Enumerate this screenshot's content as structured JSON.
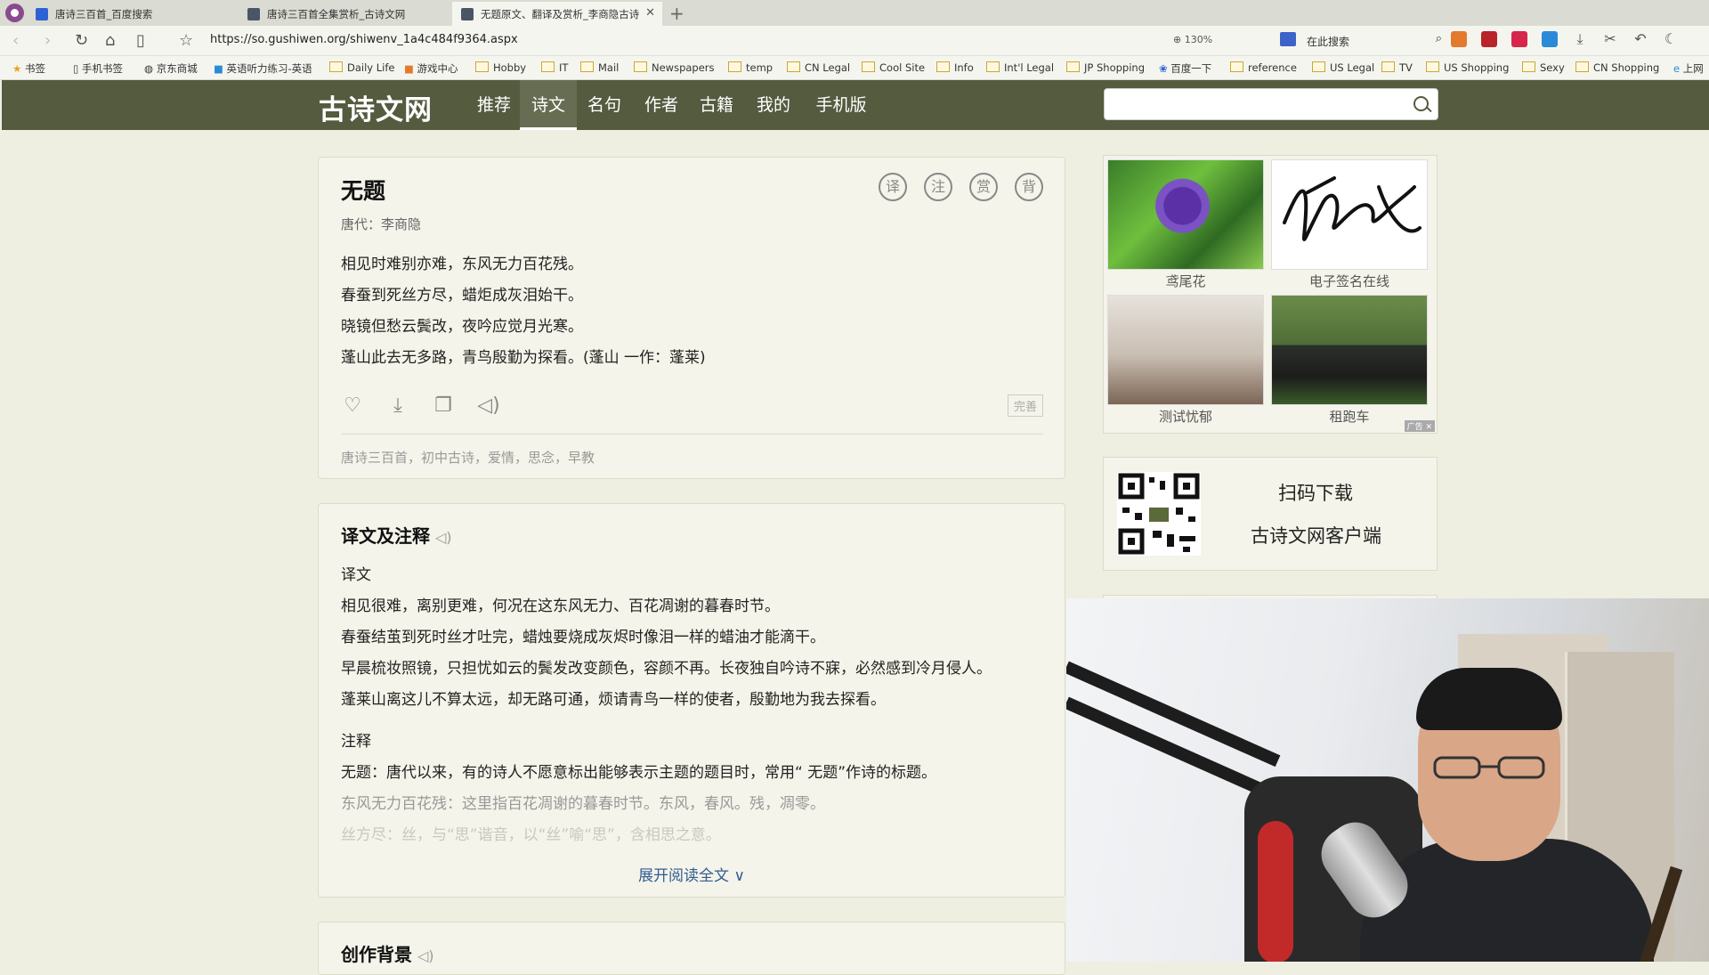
{
  "tabs": [
    {
      "title": "唐诗三百首_百度搜索"
    },
    {
      "title": "唐诗三百首全集赏析_古诗文网"
    },
    {
      "title": "无题原文、翻译及赏析_李商隐古诗"
    }
  ],
  "browser": {
    "url": "https://so.gushiwen.org/shiwenv_1a4c484f9364.aspx",
    "zoom": "130%",
    "search_placeholder": "在此搜索"
  },
  "bookmarks": [
    "书签",
    "手机书签",
    "京东商城",
    "英语听力练习-英语",
    "Daily Life",
    "游戏中心",
    "Hobby",
    "IT",
    "Mail",
    "Newspapers",
    "temp",
    "CN Legal",
    "Cool Site",
    "Info",
    "Int'l Legal",
    "JP Shopping",
    "百度一下",
    "reference",
    "US Legal",
    "TV",
    "US Shopping",
    "Sexy",
    "CN Shopping",
    "上网"
  ],
  "site": {
    "logo": "古诗文网",
    "nav": [
      "推荐",
      "诗文",
      "名句",
      "作者",
      "古籍",
      "我的",
      "手机版"
    ],
    "active_nav": "诗文"
  },
  "poem": {
    "title": "无题",
    "meta": "唐代：李商隐",
    "lines": [
      "相见时难别亦难，东风无力百花残。",
      "春蚕到死丝方尽，蜡炬成灰泪始干。",
      "晓镜但愁云鬓改，夜吟应觉月光寒。",
      "蓬山此去无多路，青鸟殷勤为探看。(蓬山 一作：蓬莱)"
    ],
    "buttons": [
      "译",
      "注",
      "赏",
      "背"
    ],
    "perfect_label": "完善",
    "tags": "唐诗三百首，初中古诗，爱情，思念，早教"
  },
  "translation": {
    "title": "译文及注释",
    "yiwen_label": "译文",
    "yiwen": [
      "相见很难，离别更难，何况在这东风无力、百花凋谢的暮春时节。",
      "春蚕结茧到死时丝才吐完，蜡烛要烧成灰烬时像泪一样的蜡油才能滴干。",
      "早晨梳妆照镜，只担忧如云的鬓发改变颜色，容颜不再。长夜独自吟诗不寐，必然感到冷月侵人。",
      "蓬莱山离这儿不算太远，却无路可通，烦请青鸟一样的使者，殷勤地为我去探看。"
    ],
    "zhushi_label": "注释",
    "zhushi": [
      "无题：唐代以来，有的诗人不愿意标出能够表示主题的题目时，常用“ 无题”作诗的标题。",
      "东风无力百花残：这里指百花凋谢的暮春时节。东风，春风。残，凋零。",
      "丝方尽：丝，与“思”谐音，以“丝”喻“思”，含相思之意。"
    ],
    "expand": "展开阅读全文 ∨"
  },
  "next_section": {
    "title": "创作背景"
  },
  "ads": [
    {
      "caption": "鸢尾花"
    },
    {
      "caption": "电子签名在线"
    },
    {
      "caption": "测试忧郁"
    },
    {
      "caption": "租跑车"
    }
  ],
  "ad_label": "广告",
  "qr": {
    "line1": "扫码下载",
    "line2": "古诗文网客户端"
  }
}
